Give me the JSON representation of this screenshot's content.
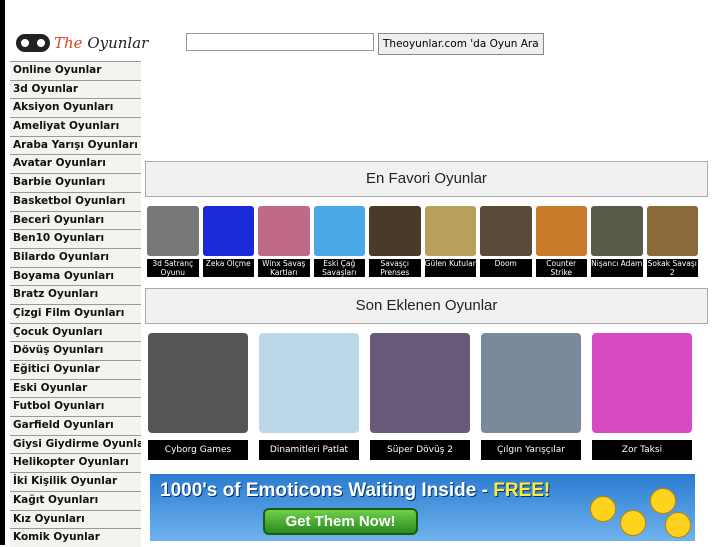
{
  "logo": {
    "the": "The",
    "oyunlar": "Oyunlar"
  },
  "search": {
    "value": "",
    "button": "Theoyunlar.com 'da Oyun Ara"
  },
  "sidebar": [
    "Online Oyunlar",
    "3d Oyunlar",
    "Aksiyon Oyunları",
    "Ameliyat Oyunları",
    "Araba Yarışı Oyunları",
    "Avatar Oyunları",
    "Barbie Oyunları",
    "Basketbol Oyunları",
    "Beceri Oyunları",
    "Ben10 Oyunları",
    "Bilardo Oyunları",
    "Boyama Oyunları",
    "Bratz Oyunları",
    "Çizgi Film Oyunları",
    "Çocuk Oyunları",
    "Dövüş Oyunları",
    "Eğitici Oyunlar",
    "Eski Oyunlar",
    "Futbol Oyunları",
    "Garfield Oyunları",
    "Giysi Giydirme Oyunları",
    "Helikopter Oyunları",
    "İki Kişilik Oyunlar",
    "Kağıt Oyunları",
    "Kız Oyunları",
    "Komik Oyunlar"
  ],
  "favorites": {
    "title": "En Favori Oyunlar",
    "items": [
      {
        "label": "3d Satranç Oyunu",
        "color": "#777"
      },
      {
        "label": "Zeka Ölçme",
        "color": "#1a2ad8"
      },
      {
        "label": "Winx Savaş Kartları",
        "color": "#c06a8a"
      },
      {
        "label": "Eski Çağ Savaşları",
        "color": "#4aa7e8"
      },
      {
        "label": "Savaşçı Prenses",
        "color": "#4a3a2a"
      },
      {
        "label": "Gülen Kutular",
        "color": "#b8a05a"
      },
      {
        "label": "Doom",
        "color": "#5a4a3a"
      },
      {
        "label": "Counter Strike",
        "color": "#c87a2a"
      },
      {
        "label": "Nişancı Adam",
        "color": "#5a5a4a"
      },
      {
        "label": "Sokak Savaşı 2",
        "color": "#8a6a3a"
      }
    ]
  },
  "recent": {
    "title": "Son Eklenen Oyunlar",
    "items": [
      {
        "label": "Cyborg Games",
        "color": "#555"
      },
      {
        "label": "Dinamitleri Patlat",
        "color": "#bcd8e8"
      },
      {
        "label": "Süper Dövüş 2",
        "color": "#6a5a7a"
      },
      {
        "label": "Çılgın Yarışçılar",
        "color": "#7a8a9a"
      },
      {
        "label": "Zor Taksi",
        "color": "#d84ac0"
      }
    ]
  },
  "banner": {
    "text": "1000's of Emoticons Waiting Inside - ",
    "free": "FREE!",
    "button": "Get Them Now!"
  }
}
